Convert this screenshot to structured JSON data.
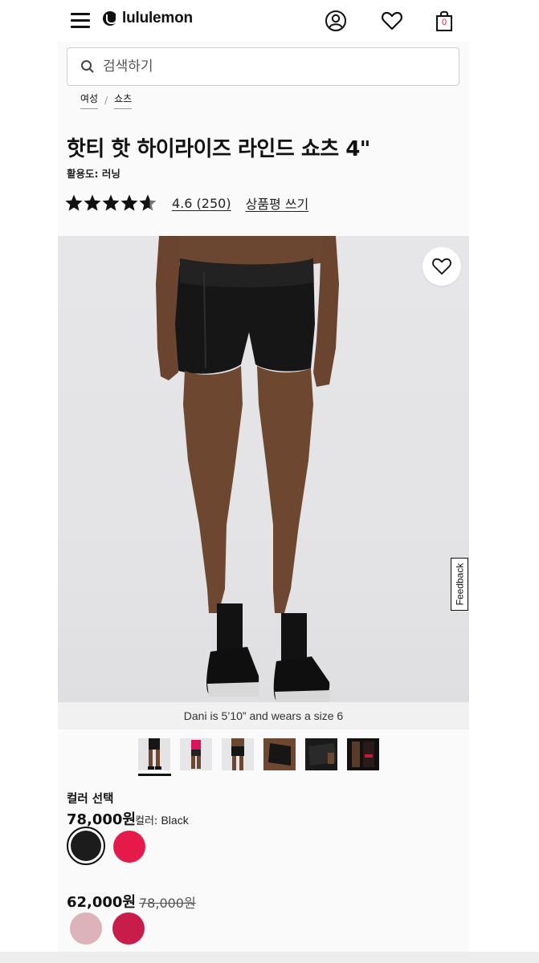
{
  "header": {
    "brand": "lululemon",
    "cart_count": "0"
  },
  "search": {
    "placeholder": "검색하기"
  },
  "breadcrumb": [
    {
      "label": "여성"
    },
    {
      "label": "쇼츠"
    }
  ],
  "product": {
    "title": "핫티 핫 하이라이즈 라인드 쇼츠 4\"",
    "activity": "활용도: 러닝",
    "rating_value": "4.6",
    "rating_count": "(250)",
    "write_review": "상품평 쓰기",
    "stars": 4.6
  },
  "gallery": {
    "caption": "Dani is 5’10” and wears a size 6",
    "thumb_count": 6,
    "selected_index": 0
  },
  "feedback_label": "Feedback",
  "color": {
    "section_label": "컬러 선택",
    "price": "78,000원",
    "color_label": "컬러:",
    "color_value": "Black",
    "swatches": [
      {
        "name": "Black",
        "hex": "#1c1c1c",
        "selected": true
      },
      {
        "name": "Pink",
        "hex": "#e6194b"
      }
    ]
  },
  "sale": {
    "price": "62,000원",
    "original_price": "78,000원",
    "swatches": [
      {
        "name": "Light Pink",
        "hex": "#dcb2bb"
      },
      {
        "name": "Crimson",
        "hex": "#c81d4a"
      }
    ]
  },
  "colors": {
    "text": "#111111",
    "accent_red": "#d31e47",
    "image_bg": "#e4e4e6"
  }
}
